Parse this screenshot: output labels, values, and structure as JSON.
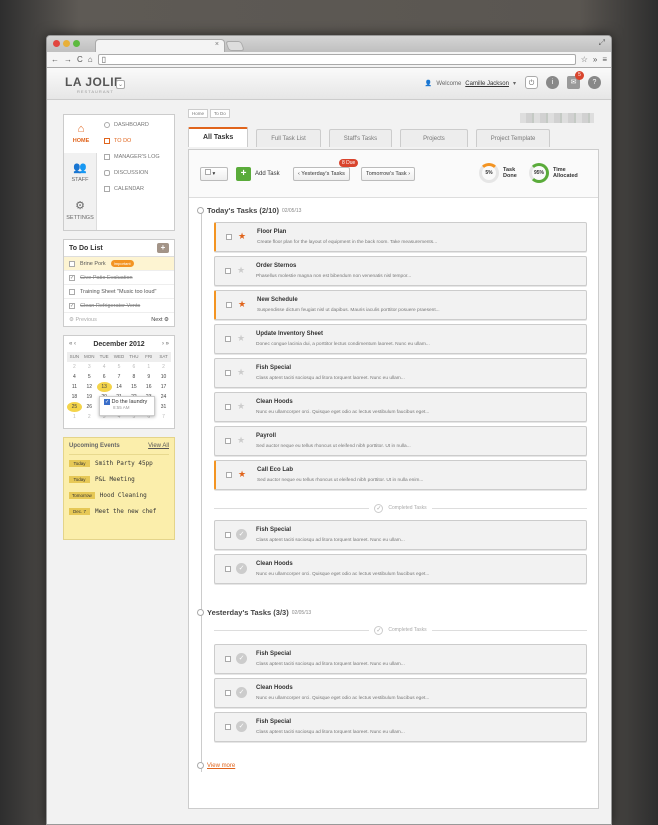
{
  "app": {
    "name": "LA JOLIE",
    "subtitle": "RESTAURANT"
  },
  "header": {
    "welcome_prefix": "Welcome",
    "user_name": "Camille Jackson",
    "notification_count": "5"
  },
  "nav": {
    "items": [
      {
        "label": "HOME",
        "icon": "home-icon"
      },
      {
        "label": "STAFF",
        "icon": "staff-icon"
      },
      {
        "label": "SETTINGS",
        "icon": "gear-icon"
      }
    ],
    "sublinks": [
      "DASHBOARD",
      "TO DO",
      "MANAGER'S LOG",
      "DISCUSSION",
      "CALENDAR"
    ]
  },
  "todo_list": {
    "title": "To Do List",
    "items": [
      {
        "text": "Brine Pork",
        "tag": "Important",
        "done": false
      },
      {
        "text": "Give Patio Evaluation",
        "done": true
      },
      {
        "text": "Training Sheet \"Music too loud\"",
        "done": false
      },
      {
        "text": "Clean Refrigerator Vents",
        "done": true
      }
    ],
    "prev": "Previous",
    "next": "Next"
  },
  "calendar": {
    "month": "December 2012",
    "days": [
      "SUN",
      "MON",
      "TUE",
      "WED",
      "THU",
      "FRI",
      "SAT"
    ],
    "weeks": [
      [
        "2",
        "3",
        "4",
        "5",
        "6",
        "1",
        "2"
      ],
      [
        "4",
        "5",
        "6",
        "7",
        "8",
        "9",
        "10"
      ],
      [
        "11",
        "12",
        "13",
        "14",
        "15",
        "16",
        "17"
      ],
      [
        "18",
        "19",
        "20",
        "21",
        "22",
        "23",
        "24"
      ],
      [
        "25",
        "26",
        "27",
        "28",
        "29",
        "30",
        "31"
      ],
      [
        "1",
        "2",
        "3",
        "4",
        "5",
        "6",
        "7"
      ]
    ],
    "popup_text": "Do the laundry",
    "popup_time": "8:55 AM"
  },
  "events": {
    "title": "Upcoming Events",
    "view_all": "View All",
    "items": [
      {
        "date": "Today",
        "text": "Smith Party 45pp"
      },
      {
        "date": "Today",
        "text": "P&L Meeting"
      },
      {
        "date": "Tomorrow",
        "text": "Hood Cleaning"
      },
      {
        "date": "Dec. 7",
        "text": "Meet the new chef"
      }
    ]
  },
  "breadcrumb": [
    "Home",
    "To Do"
  ],
  "tabs": [
    "All Tasks",
    "Full Task List",
    "Staff's Tasks",
    "Projects",
    "Project Template"
  ],
  "toolbar": {
    "add_task": "Add Task",
    "yesterday": "Yesterday's Tasks",
    "due_badge": "8 Due",
    "tomorrow": "Tomorrow's Task",
    "task_done_pct": "5%",
    "task_done_label": "Task Done",
    "time_alloc_pct": "95%",
    "time_alloc_label": "Time Allocated"
  },
  "today": {
    "title": "Today's Tasks (2/10)",
    "date": "02/05/13",
    "tasks": [
      {
        "title": "Floor Plan",
        "desc": "Create floor plan for the layout of equipment in the back room. Take measurements...",
        "starred": true
      },
      {
        "title": "Order Sternos",
        "desc": "Phasellus molestie magna non est bibendum non venenatis nisl tempor...",
        "starred": false
      },
      {
        "title": "New Schedule",
        "desc": "Suspendisse dictum feugiat nisl ut dapibus. Mauris iaculis porttitor posuere praesent...",
        "starred": true
      },
      {
        "title": "Update Inventory Sheet",
        "desc": "Donec congue lacinia dui, a porttitor lectus condimentum laoreet. Nunc eu ullam...",
        "starred": false
      },
      {
        "title": "Fish Special",
        "desc": "Class aptent taciti sociosqu ad litora torquent laoreet. Nunc eu ullam...",
        "starred": false
      },
      {
        "title": "Clean Hoods",
        "desc": "Nunc eu ullamcorper orci. Quisque eget odio ac lectus vestibulum faucibus eget...",
        "starred": false
      },
      {
        "title": "Payroll",
        "desc": "Sed auctor neque eu tellus rhoncus ut eleifend nibh porttitor. Ut in nulla...",
        "starred": false
      },
      {
        "title": "Call Eco Lab",
        "desc": "Sed auctor neque eu tellus rhoncus ut eleifend nibh porttitor. Ut in nulla enim...",
        "starred": true
      }
    ],
    "completed_label": "Completed Tasks",
    "completed": [
      {
        "title": "Fish Special",
        "desc": "Class aptent taciti sociosqu ad litora torquent laoreet. Nunc eu ullam..."
      },
      {
        "title": "Clean Hoods",
        "desc": "Nunc eu ullamcorper orci. Quisque eget odio ac lectus vestibulum faucibus eget..."
      }
    ]
  },
  "yesterday": {
    "title": "Yesterday's Tasks (3/3)",
    "date": "02/05/13",
    "completed_label": "Completed Tasks",
    "completed": [
      {
        "title": "Fish Special",
        "desc": "Class aptent taciti sociosqu ad litora torquent laoreet. Nunc eu ullam..."
      },
      {
        "title": "Clean Hoods",
        "desc": "Nunc eu ullamcorper orci. Quisque eget odio ac lectus vestibulum faucibus eget..."
      },
      {
        "title": "Fish Special",
        "desc": "Class aptent taciti sociosqu ad litora torquent laoreet. Nunc eu ullam..."
      }
    ]
  },
  "view_more": "View more",
  "colors": {
    "accent": "#e0641c",
    "flag": "#f39422",
    "green": "#5aab3a",
    "badge": "#d9442d"
  }
}
